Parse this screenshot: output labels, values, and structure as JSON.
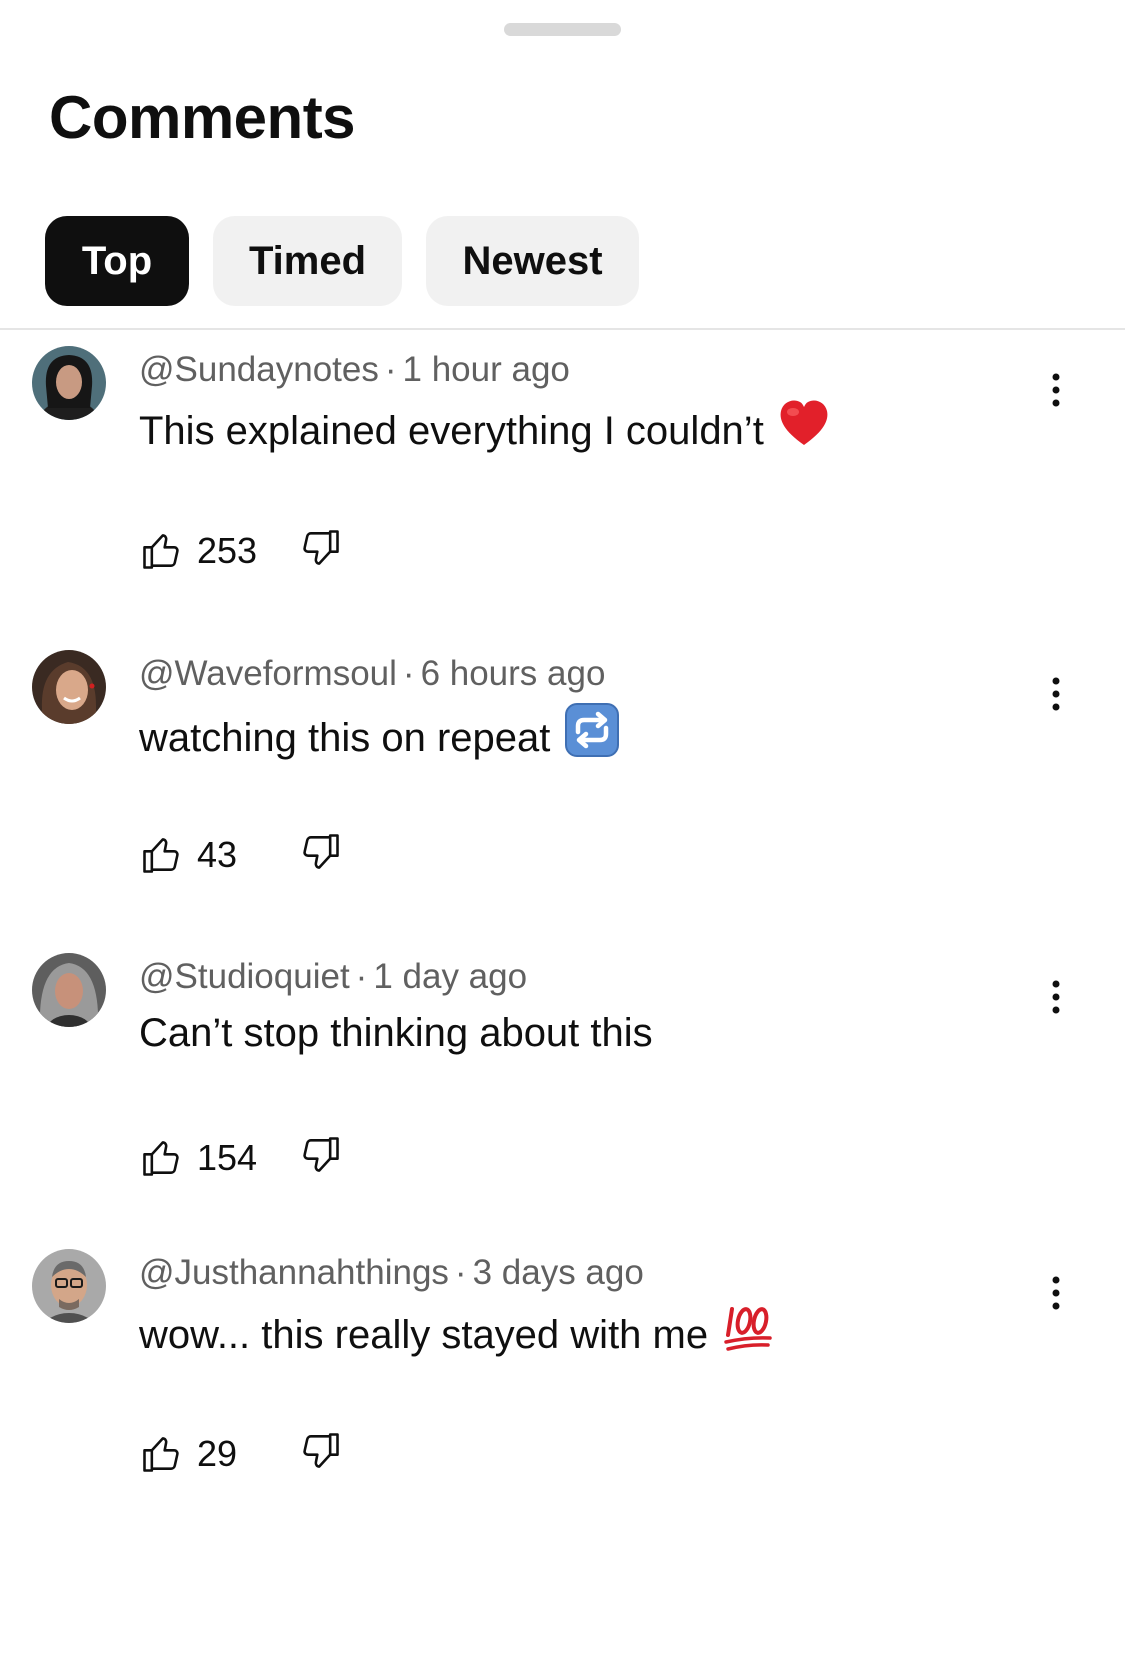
{
  "header": {
    "title": "Comments"
  },
  "tabs": [
    {
      "label": "Top",
      "active": true
    },
    {
      "label": "Timed",
      "active": false
    },
    {
      "label": "Newest",
      "active": false
    }
  ],
  "separator": "·",
  "colors": {
    "accent": "#0f0f0f",
    "chip_bg": "#f1f1f1",
    "meta": "#606060",
    "divider": "#e5e5e5"
  },
  "comments": [
    {
      "author": "@Sundaynotes",
      "time": "1 hour ago",
      "text": "This explained everything I couldn’t",
      "emoji": "red-heart-emoji",
      "likes": "253",
      "avatar_colors": [
        "#4f6f7a",
        "#1e1e1e",
        "#c89a82"
      ]
    },
    {
      "author": "@Waveformsoul",
      "time": "6 hours ago",
      "text": "watching this on repeat",
      "emoji": "repeat-button-emoji",
      "likes": "43",
      "avatar_colors": [
        "#3a2a22",
        "#7a4f38",
        "#d9a88a"
      ]
    },
    {
      "author": "@Studioquiet",
      "time": "1 day ago",
      "text": "Can’t stop thinking about this",
      "emoji": "",
      "likes": "154",
      "avatar_colors": [
        "#8f8f8f",
        "#3b3b3b",
        "#c7917a"
      ]
    },
    {
      "author": "@Justhannahthings",
      "time": "3 days ago",
      "text": "wow... this really stayed with me",
      "emoji": "hundred-points-emoji",
      "likes": "29",
      "avatar_colors": [
        "#a9a9a9",
        "#505050",
        "#d3a689"
      ]
    }
  ]
}
